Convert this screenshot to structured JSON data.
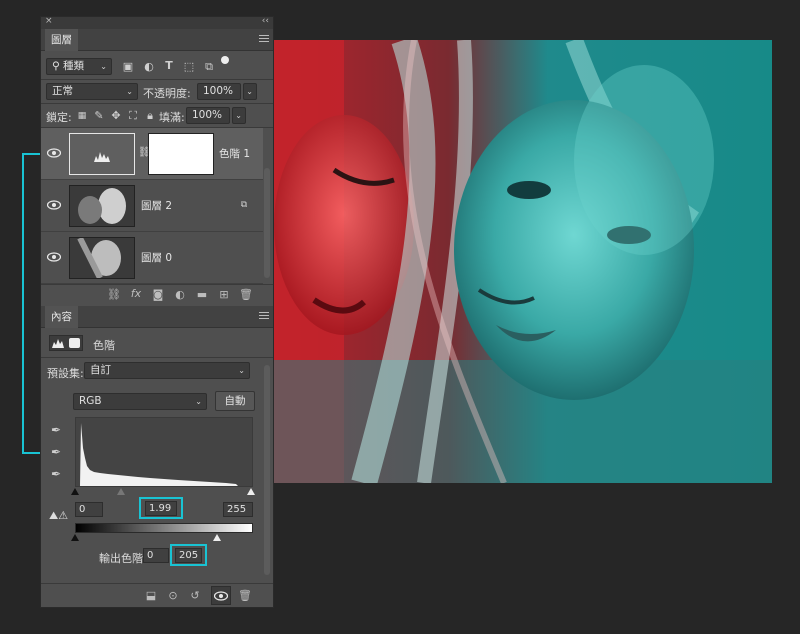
{
  "layers_panel": {
    "tab": "圖層",
    "filter": "種類",
    "blend_mode": "正常",
    "opacity_label": "不透明度:",
    "opacity_value": "100%",
    "lock_label": "鎖定:",
    "fill_label": "填滿:",
    "fill_value": "100%",
    "layers": [
      {
        "name": "色階 1",
        "selected": true
      },
      {
        "name": "圖層 2",
        "selected": false
      },
      {
        "name": "圖層 0",
        "selected": false
      }
    ]
  },
  "properties_panel": {
    "tab": "內容",
    "adjustment": "色階",
    "preset_label": "預設集:",
    "preset_value": "自訂",
    "channel": "RGB",
    "auto_label": "自動",
    "input_black": "0",
    "input_gamma": "1.99",
    "input_white": "255",
    "output_label": "輸出色階:",
    "output_black": "0",
    "output_white": "205"
  },
  "colors": {
    "highlight": "#19c3d3"
  }
}
